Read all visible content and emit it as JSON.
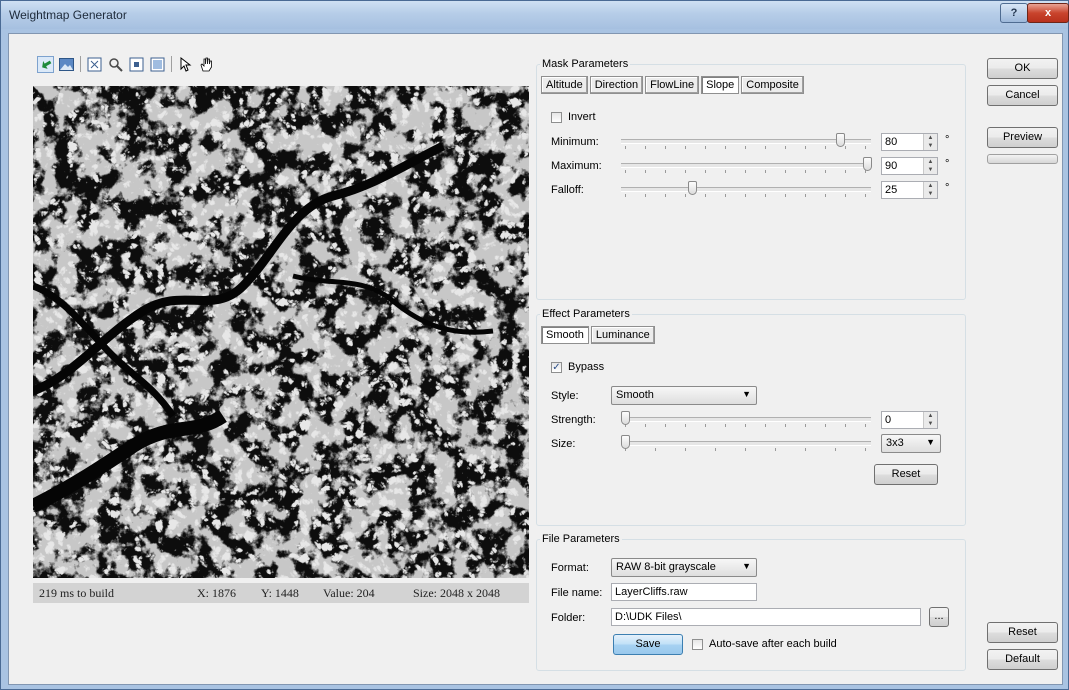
{
  "window": {
    "title": "Weightmap Generator",
    "help_label": "?",
    "close_label": "x"
  },
  "toolbar": {
    "icons": [
      "refresh-icon",
      "image-icon",
      "zoom-fit-icon",
      "zoom-100-icon",
      "zoom-in-icon",
      "zoom-out-icon",
      "pointer-icon",
      "hand-pan-icon"
    ]
  },
  "statusbar": {
    "build_time": "219 ms to build",
    "x": "X:  1876",
    "y": "Y:  1448",
    "value": "Value:  204",
    "size": "Size:  2048 x 2048"
  },
  "mask": {
    "group_label": "Mask Parameters",
    "tabs": [
      "Altitude",
      "Direction",
      "FlowLine",
      "Slope",
      "Composite"
    ],
    "selected_tab": "Slope",
    "invert_label": "Invert",
    "invert_checked": false,
    "minimum_label": "Minimum:",
    "minimum_value": "80",
    "maximum_label": "Maximum:",
    "maximum_value": "90",
    "falloff_label": "Falloff:",
    "falloff_value": "25",
    "unit": "°",
    "slider_range": [
      0,
      90
    ]
  },
  "effect": {
    "group_label": "Effect Parameters",
    "tabs": [
      "Smooth",
      "Luminance"
    ],
    "selected_tab": "Smooth",
    "bypass_label": "Bypass",
    "bypass_checked": true,
    "check_mark": "✓",
    "style_label": "Style:",
    "style_value": "Smooth",
    "strength_label": "Strength:",
    "strength_value": "0",
    "size_label": "Size:",
    "size_value": "3x3",
    "reset_label": "Reset"
  },
  "file": {
    "group_label": "File Parameters",
    "format_label": "Format:",
    "format_value": "RAW 8-bit grayscale",
    "filename_label": "File name:",
    "filename_value": "LayerCliffs.raw",
    "folder_label": "Folder:",
    "folder_value": "D:\\UDK Files\\",
    "browse_label": "...",
    "save_label": "Save",
    "autosave_label": "Auto-save after each build",
    "autosave_checked": false
  },
  "actions": {
    "ok_label": "OK",
    "cancel_label": "Cancel",
    "preview_label": "Preview",
    "reset_label": "Reset",
    "default_label": "Default",
    "preview_progress": 0
  }
}
